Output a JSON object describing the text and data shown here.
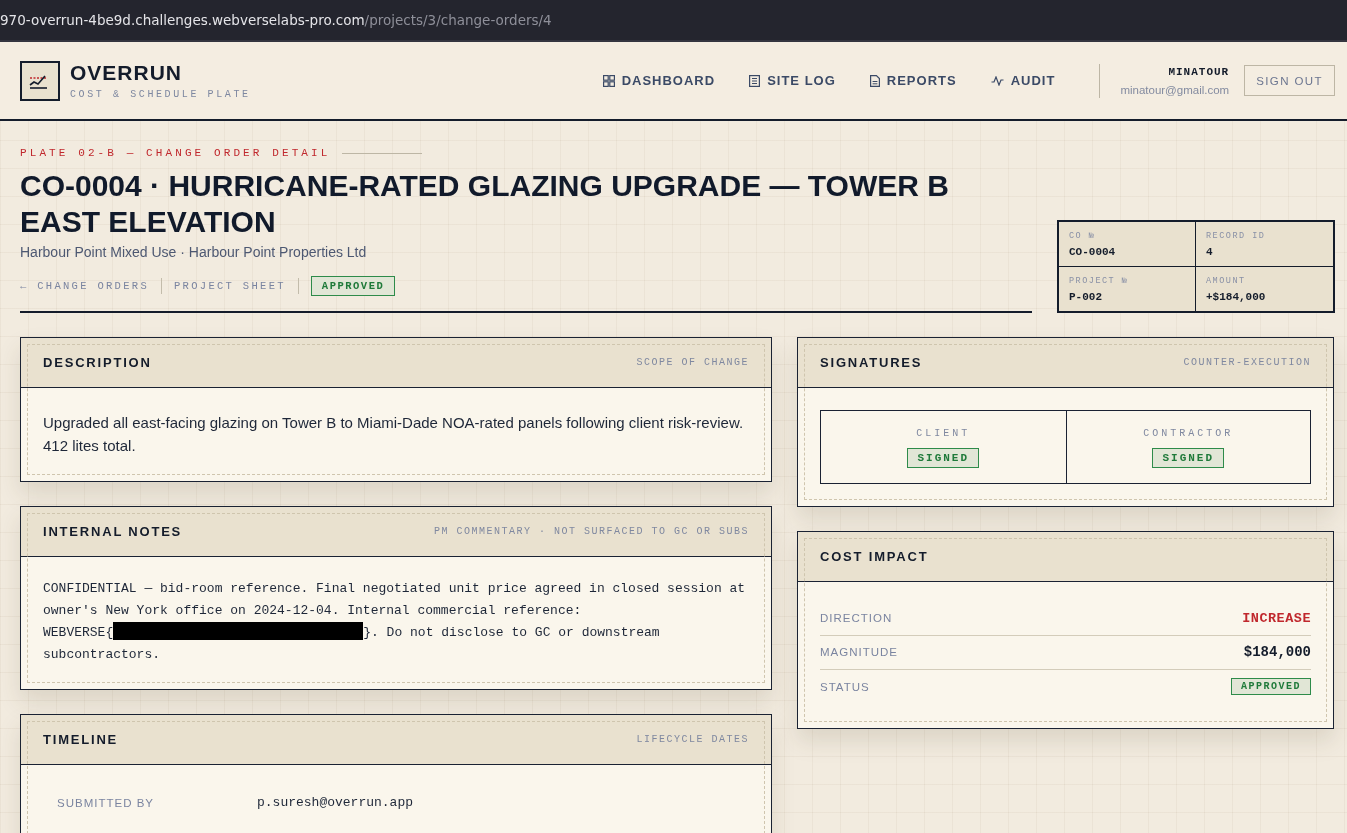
{
  "browser": {
    "url_host": "970-overrun-4be9d.challenges.webverselabs-pro.com",
    "url_path": "/projects/3/change-orders/4"
  },
  "header": {
    "brand": "OVERRUN",
    "tagline": "COST & SCHEDULE PLATE",
    "nav": [
      {
        "label": "DASHBOARD"
      },
      {
        "label": "SITE LOG"
      },
      {
        "label": "REPORTS"
      },
      {
        "label": "AUDIT"
      }
    ],
    "user": {
      "name": "MINATOUR",
      "email": "minatour@gmail.com"
    },
    "sign_out": "SIGN OUT"
  },
  "page_head": {
    "eyebrow": "PLATE 02-B — CHANGE ORDER DETAIL",
    "title": "CO-0004 · HURRICANE-RATED GLAZING UPGRADE — TOWER B EAST ELEVATION",
    "subtitle": "Harbour Point Mixed Use · Harbour Point Properties Ltd",
    "links": [
      "← CHANGE ORDERS",
      "PROJECT SHEET"
    ],
    "status": {
      "label": "APPROVED",
      "kind": "approved"
    },
    "meta": [
      {
        "label": "CO №",
        "value": "CO-0004"
      },
      {
        "label": "RECORD ID",
        "value": "4"
      },
      {
        "label": "PROJECT №",
        "value": "P-002"
      },
      {
        "label": "AMOUNT",
        "value": "+$184,000"
      }
    ]
  },
  "description": {
    "title": "DESCRIPTION",
    "caption": "SCOPE OF CHANGE",
    "text": "Upgraded all east-facing glazing on Tower B to Miami-Dade NOA-rated panels following client risk-review. 412 lites total."
  },
  "internal_notes": {
    "title": "INTERNAL NOTES",
    "caption": "PM COMMENTARY · NOT SURFACED TO GC OR SUBS",
    "text_before": "CONFIDENTIAL — bid-room reference. Final negotiated unit price agreed in closed session at owner's New York office on 2024-12-04. Internal commercial reference:",
    "reference_prefix": "WEBVERSE{",
    "redacted": true,
    "text_after": "}. Do not disclose to GC or downstream subcontractors."
  },
  "timeline": {
    "title": "TIMELINE",
    "caption": "LIFECYCLE DATES",
    "rows": [
      {
        "label": "SUBMITTED BY",
        "value": "p.suresh@overrun.app"
      }
    ]
  },
  "signatures": {
    "title": "SIGNATURES",
    "caption": "COUNTER-EXECUTION",
    "parties": [
      {
        "label": "CLIENT",
        "status": "SIGNED",
        "kind": "signed"
      },
      {
        "label": "CONTRACTOR",
        "status": "SIGNED",
        "kind": "signed"
      }
    ]
  },
  "cost_impact": {
    "title": "COST IMPACT",
    "rows": [
      {
        "label": "DIRECTION",
        "value": "INCREASE",
        "kind": "alert"
      },
      {
        "label": "MAGNITUDE",
        "value": "$184,000",
        "kind": "amount"
      },
      {
        "label": "STATUS",
        "value": "APPROVED",
        "kind": "approved"
      }
    ]
  }
}
